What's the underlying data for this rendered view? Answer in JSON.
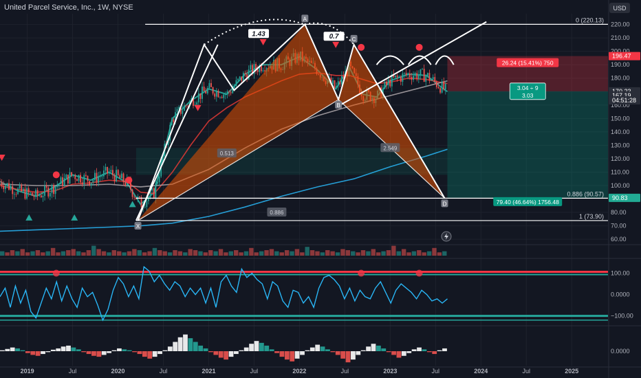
{
  "header": {
    "symbol_title": "United Parcel Service, Inc., 1W, NYSE",
    "currency_button": "USD"
  },
  "chart_data": [
    {
      "type": "line",
      "panel": "price",
      "ylim": [
        58,
        228
      ],
      "price_axis_ticks": [
        60,
        70,
        80,
        90,
        100,
        110,
        120,
        130,
        140,
        150,
        160,
        170,
        180,
        190,
        200,
        210,
        220
      ],
      "price_axis_labels": [
        "60.00",
        "70.00",
        "80.00",
        "90.00",
        "100.00",
        "110.00",
        "120.00",
        "130.00",
        "140.00",
        "150.00",
        "160.00",
        "170.00",
        "180.00",
        "190.00",
        "200.00",
        "210.00",
        "220.00"
      ],
      "time_axis_labels": [
        {
          "label": "2019",
          "t": 2019.0
        },
        {
          "label": "Jul",
          "t": 2019.5
        },
        {
          "label": "2020",
          "t": 2020.0
        },
        {
          "label": "Jul",
          "t": 2020.5
        },
        {
          "label": "2021",
          "t": 2021.0
        },
        {
          "label": "Jul",
          "t": 2021.5
        },
        {
          "label": "2022",
          "t": 2022.0
        },
        {
          "label": "Jul",
          "t": 2022.5
        },
        {
          "label": "2023",
          "t": 2023.0
        },
        {
          "label": "Jul",
          "t": 2023.5
        },
        {
          "label": "2024",
          "t": 2024.0
        },
        {
          "label": "Jul",
          "t": 2024.5
        },
        {
          "label": "2025",
          "t": 2025.0
        }
      ],
      "xlim": [
        2018.7,
        2025.4
      ],
      "fib_levels": [
        {
          "label": "0 (220.13)",
          "value": 220.13
        },
        {
          "label": "0.886 (90.57)",
          "value": 90.57
        },
        {
          "label": "1 (73.90)",
          "value": 73.9
        }
      ],
      "price_badges": [
        {
          "label": "196.47",
          "value": 196.47,
          "color": "#f23645"
        },
        {
          "label": "170.23",
          "value": 170.23,
          "color": "#2a2e39"
        },
        {
          "label": "167.19",
          "value": 167.19,
          "color": "#2a2e39"
        },
        {
          "label": "04:51:28",
          "value": 163.5,
          "color": "#2a2e39"
        },
        {
          "label": "90.83",
          "value": 90.83,
          "color": "#22ab94"
        }
      ],
      "pattern_points": [
        {
          "name": "X",
          "t": 2020.22,
          "v": 73.9,
          "label": "X"
        },
        {
          "name": "H1",
          "t": 2020.95,
          "v": 205,
          "label": ""
        },
        {
          "name": "L1",
          "t": 2021.28,
          "v": 171,
          "label": ""
        },
        {
          "name": "A",
          "t": 2022.06,
          "v": 220.13,
          "label": "A"
        },
        {
          "name": "B",
          "t": 2022.43,
          "v": 164,
          "label": "B"
        },
        {
          "name": "C",
          "t": 2022.6,
          "v": 205,
          "label": "C"
        },
        {
          "name": "D",
          "t": 2023.6,
          "v": 90.57,
          "label": "D"
        }
      ],
      "pattern_ratios": [
        {
          "label": "1.43",
          "t": 2021.55,
          "v": 213
        },
        {
          "label": "0.7",
          "t": 2022.38,
          "v": 211
        },
        {
          "label": "0.513",
          "t": 2021.2,
          "v": 124
        },
        {
          "label": "2.549",
          "t": 2023.0,
          "v": 128
        },
        {
          "label": "0.886",
          "t": 2021.75,
          "v": 80
        }
      ],
      "trade_box": {
        "start_t": 2023.63,
        "end_t": 2025.45,
        "entry": 170.23,
        "stop": 196.47,
        "target": 90.83,
        "stop_label": "26.24 (15.41%) 750",
        "ratio_label_1": "3.04 ÷ 9",
        "ratio_label_2": "3.03",
        "target_label": "79.40 (46.64%) 1756.48"
      },
      "series": [
        {
          "name": "",
          "color": "#26a69a",
          "x": [
            2018.7,
            2018.9,
            2019.1,
            2019.3,
            2019.5,
            2019.7,
            2019.9,
            2020.1,
            2020.25,
            2020.4,
            2020.6,
            2020.8,
            2021.0,
            2021.2,
            2021.4,
            2021.6,
            2021.8,
            2022.0,
            2022.2,
            2022.4,
            2022.55,
            2022.7,
            2022.85,
            2023.0,
            2023.2,
            2023.4,
            2023.55,
            2023.63
          ],
          "values": [
            103,
            96,
            92,
            99,
            108,
            104,
            110,
            102,
            86,
            95,
            150,
            163,
            172,
            168,
            183,
            190,
            190,
            196,
            186,
            172,
            188,
            168,
            166,
            178,
            183,
            182,
            174,
            170
          ]
        },
        {
          "name": "",
          "color": "#e53935",
          "x": [
            2018.7,
            2018.9,
            2019.1,
            2019.3,
            2019.5,
            2019.7,
            2019.9,
            2020.1,
            2020.25,
            2020.4,
            2020.6,
            2020.8,
            2021.0,
            2021.2,
            2021.4,
            2021.6,
            2021.8,
            2022.0,
            2022.2,
            2022.4,
            2022.55,
            2022.7,
            2022.85,
            2023.0,
            2023.2,
            2023.4,
            2023.55,
            2023.63
          ],
          "values": [
            100,
            97,
            95,
            96,
            101,
            102,
            104,
            103,
            95,
            94,
            110,
            130,
            148,
            158,
            166,
            172,
            178,
            183,
            184,
            182,
            182,
            179,
            176,
            177,
            180,
            179,
            177,
            176
          ]
        },
        {
          "name": "",
          "color": "#b2a9ad",
          "x": [
            2018.7,
            2019.1,
            2019.5,
            2019.9,
            2020.25,
            2020.6,
            2021.0,
            2021.4,
            2021.8,
            2022.2,
            2022.6,
            2023.0,
            2023.4,
            2023.63
          ],
          "values": [
            101,
            100,
            100,
            101,
            99,
            101,
            112,
            128,
            142,
            152,
            160,
            167,
            174,
            178
          ]
        },
        {
          "name": "",
          "color": "#29b6f6",
          "x": [
            2018.7,
            2019.1,
            2019.5,
            2019.9,
            2020.25,
            2020.6,
            2021.0,
            2021.4,
            2021.8,
            2022.2,
            2022.6,
            2023.0,
            2023.4,
            2023.63
          ],
          "values": [
            66,
            67,
            68,
            69,
            70,
            72,
            77,
            84,
            92,
            99,
            105,
            114,
            122,
            127
          ]
        }
      ],
      "event_markers": [
        {
          "shape": "triangle-down",
          "t": 2018.72,
          "v": 121,
          "color": "#f23645"
        },
        {
          "shape": "triangle-up",
          "t": 2019.02,
          "v": 76,
          "color": "#26a69a"
        },
        {
          "shape": "triangle-up",
          "t": 2019.52,
          "v": 76,
          "color": "#26a69a"
        },
        {
          "shape": "circle",
          "t": 2019.32,
          "v": 108,
          "color": "#f23645"
        },
        {
          "shape": "triangle-up",
          "t": 2020.16,
          "v": 86,
          "color": "#26a69a"
        },
        {
          "shape": "circle",
          "t": 2020.12,
          "v": 104,
          "color": "#f23645"
        },
        {
          "shape": "triangle-down",
          "t": 2020.88,
          "v": 158,
          "color": "#f23645"
        },
        {
          "shape": "triangle-down",
          "t": 2021.6,
          "v": 207,
          "color": "#f23645"
        },
        {
          "shape": "triangle-down",
          "t": 2022.4,
          "v": 205,
          "color": "#f23645"
        },
        {
          "shape": "circle",
          "t": 2022.68,
          "v": 203,
          "color": "#f23645"
        },
        {
          "shape": "circle",
          "t": 2023.32,
          "v": 203,
          "color": "#f23645"
        }
      ]
    },
    {
      "type": "line",
      "panel": "oscillator",
      "ylim": [
        -140,
        150
      ],
      "ticks": [
        {
          "label": "100.00",
          "value": 100
        },
        {
          "label": "0.0000",
          "value": 0
        },
        {
          "label": "−100.00",
          "value": -100
        }
      ],
      "series": [
        {
          "name": "",
          "color": "#29b6f6",
          "values": [
            -10,
            30,
            -60,
            40,
            -40,
            20,
            -80,
            -110,
            -40,
            30,
            -20,
            60,
            -30,
            40,
            -20,
            -60,
            30,
            -10,
            10,
            -50,
            -120,
            -70,
            20,
            80,
            50,
            -10,
            40,
            -20,
            130,
            110,
            60,
            90,
            50,
            20,
            60,
            40,
            -10,
            30,
            0,
            30,
            -40,
            30,
            -60,
            60,
            90,
            40,
            10,
            120,
            80,
            100,
            70,
            50,
            -20,
            60,
            40,
            -30,
            -60,
            20,
            10,
            -40,
            -10,
            -60,
            30,
            80,
            90,
            70,
            40,
            -20,
            30,
            -30,
            20,
            -10,
            -20,
            30,
            60,
            10,
            -40,
            20,
            50,
            30,
            10,
            -20,
            20,
            0,
            -30,
            -20,
            -40,
            -20
          ]
        }
      ]
    },
    {
      "type": "bar",
      "panel": "histogram",
      "ylim": [
        -1,
        1
      ],
      "ticks": [
        {
          "label": "0.0000",
          "value": 0
        }
      ],
      "values": [
        0.05,
        0.12,
        0.2,
        0.15,
        0.05,
        -0.1,
        -0.2,
        -0.25,
        -0.15,
        -0.05,
        0.08,
        0.15,
        0.25,
        0.3,
        0.2,
        0.1,
        -0.05,
        -0.15,
        -0.25,
        -0.3,
        -0.2,
        -0.1,
        0.05,
        0.15,
        0.1,
        0.05,
        -0.05,
        -0.15,
        -0.3,
        -0.4,
        -0.3,
        -0.15,
        0.05,
        0.25,
        0.5,
        0.75,
        0.9,
        0.7,
        0.5,
        0.3,
        0.15,
        -0.05,
        -0.2,
        -0.35,
        -0.45,
        -0.3,
        -0.15,
        0.05,
        0.2,
        0.4,
        0.55,
        0.45,
        0.3,
        0.1,
        -0.1,
        -0.3,
        -0.45,
        -0.55,
        -0.4,
        -0.2,
        0.05,
        0.2,
        0.35,
        0.25,
        0.1,
        -0.05,
        -0.2,
        -0.4,
        -0.6,
        -0.45,
        -0.2,
        0.05,
        0.25,
        0.4,
        0.3,
        0.15,
        -0.05,
        -0.2,
        -0.35,
        -0.25,
        -0.1,
        0.1,
        0.2,
        0.1,
        -0.05,
        -0.15,
        0.05,
        0.15
      ]
    }
  ],
  "volume": {
    "values": [
      0.4,
      0.3,
      0.5,
      0.4,
      0.6,
      0.3,
      0.4,
      0.5,
      0.3,
      0.4,
      0.7,
      0.3,
      0.4,
      0.5,
      0.6,
      0.4,
      0.3,
      0.5,
      0.9,
      0.6,
      0.4,
      0.3,
      0.5,
      0.4,
      0.3,
      0.4,
      0.6,
      0.5,
      0.3,
      0.4,
      0.7,
      0.5,
      0.4,
      0.3,
      0.5,
      0.4,
      0.3,
      0.6,
      0.5,
      0.4,
      0.3,
      0.5,
      0.4,
      0.6,
      0.3,
      0.4,
      0.5,
      0.3,
      0.4,
      0.7,
      0.3,
      0.4,
      0.5,
      0.6,
      0.4,
      0.3,
      0.5,
      0.4,
      0.6,
      0.3,
      0.8,
      0.5,
      0.4,
      0.3,
      0.5,
      0.4,
      0.3,
      0.6,
      0.5,
      0.4,
      0.3,
      0.5,
      0.4,
      0.6,
      0.3,
      0.4,
      0.5,
      0.9,
      0.4,
      0.6,
      0.3,
      0.4,
      0.5,
      0.3,
      0.4,
      0.7,
      0.3,
      0.4
    ]
  },
  "colors": {
    "background": "#131722",
    "bull": "#26a69a",
    "bear": "#ef5350",
    "pattern_fill": "#e65100",
    "stop_zone": "#f23645",
    "target_zone": "#089981",
    "text": "#d1d4dc",
    "axis_text": "#b2b5be"
  },
  "icons": {
    "lightning": "lightning-icon"
  }
}
